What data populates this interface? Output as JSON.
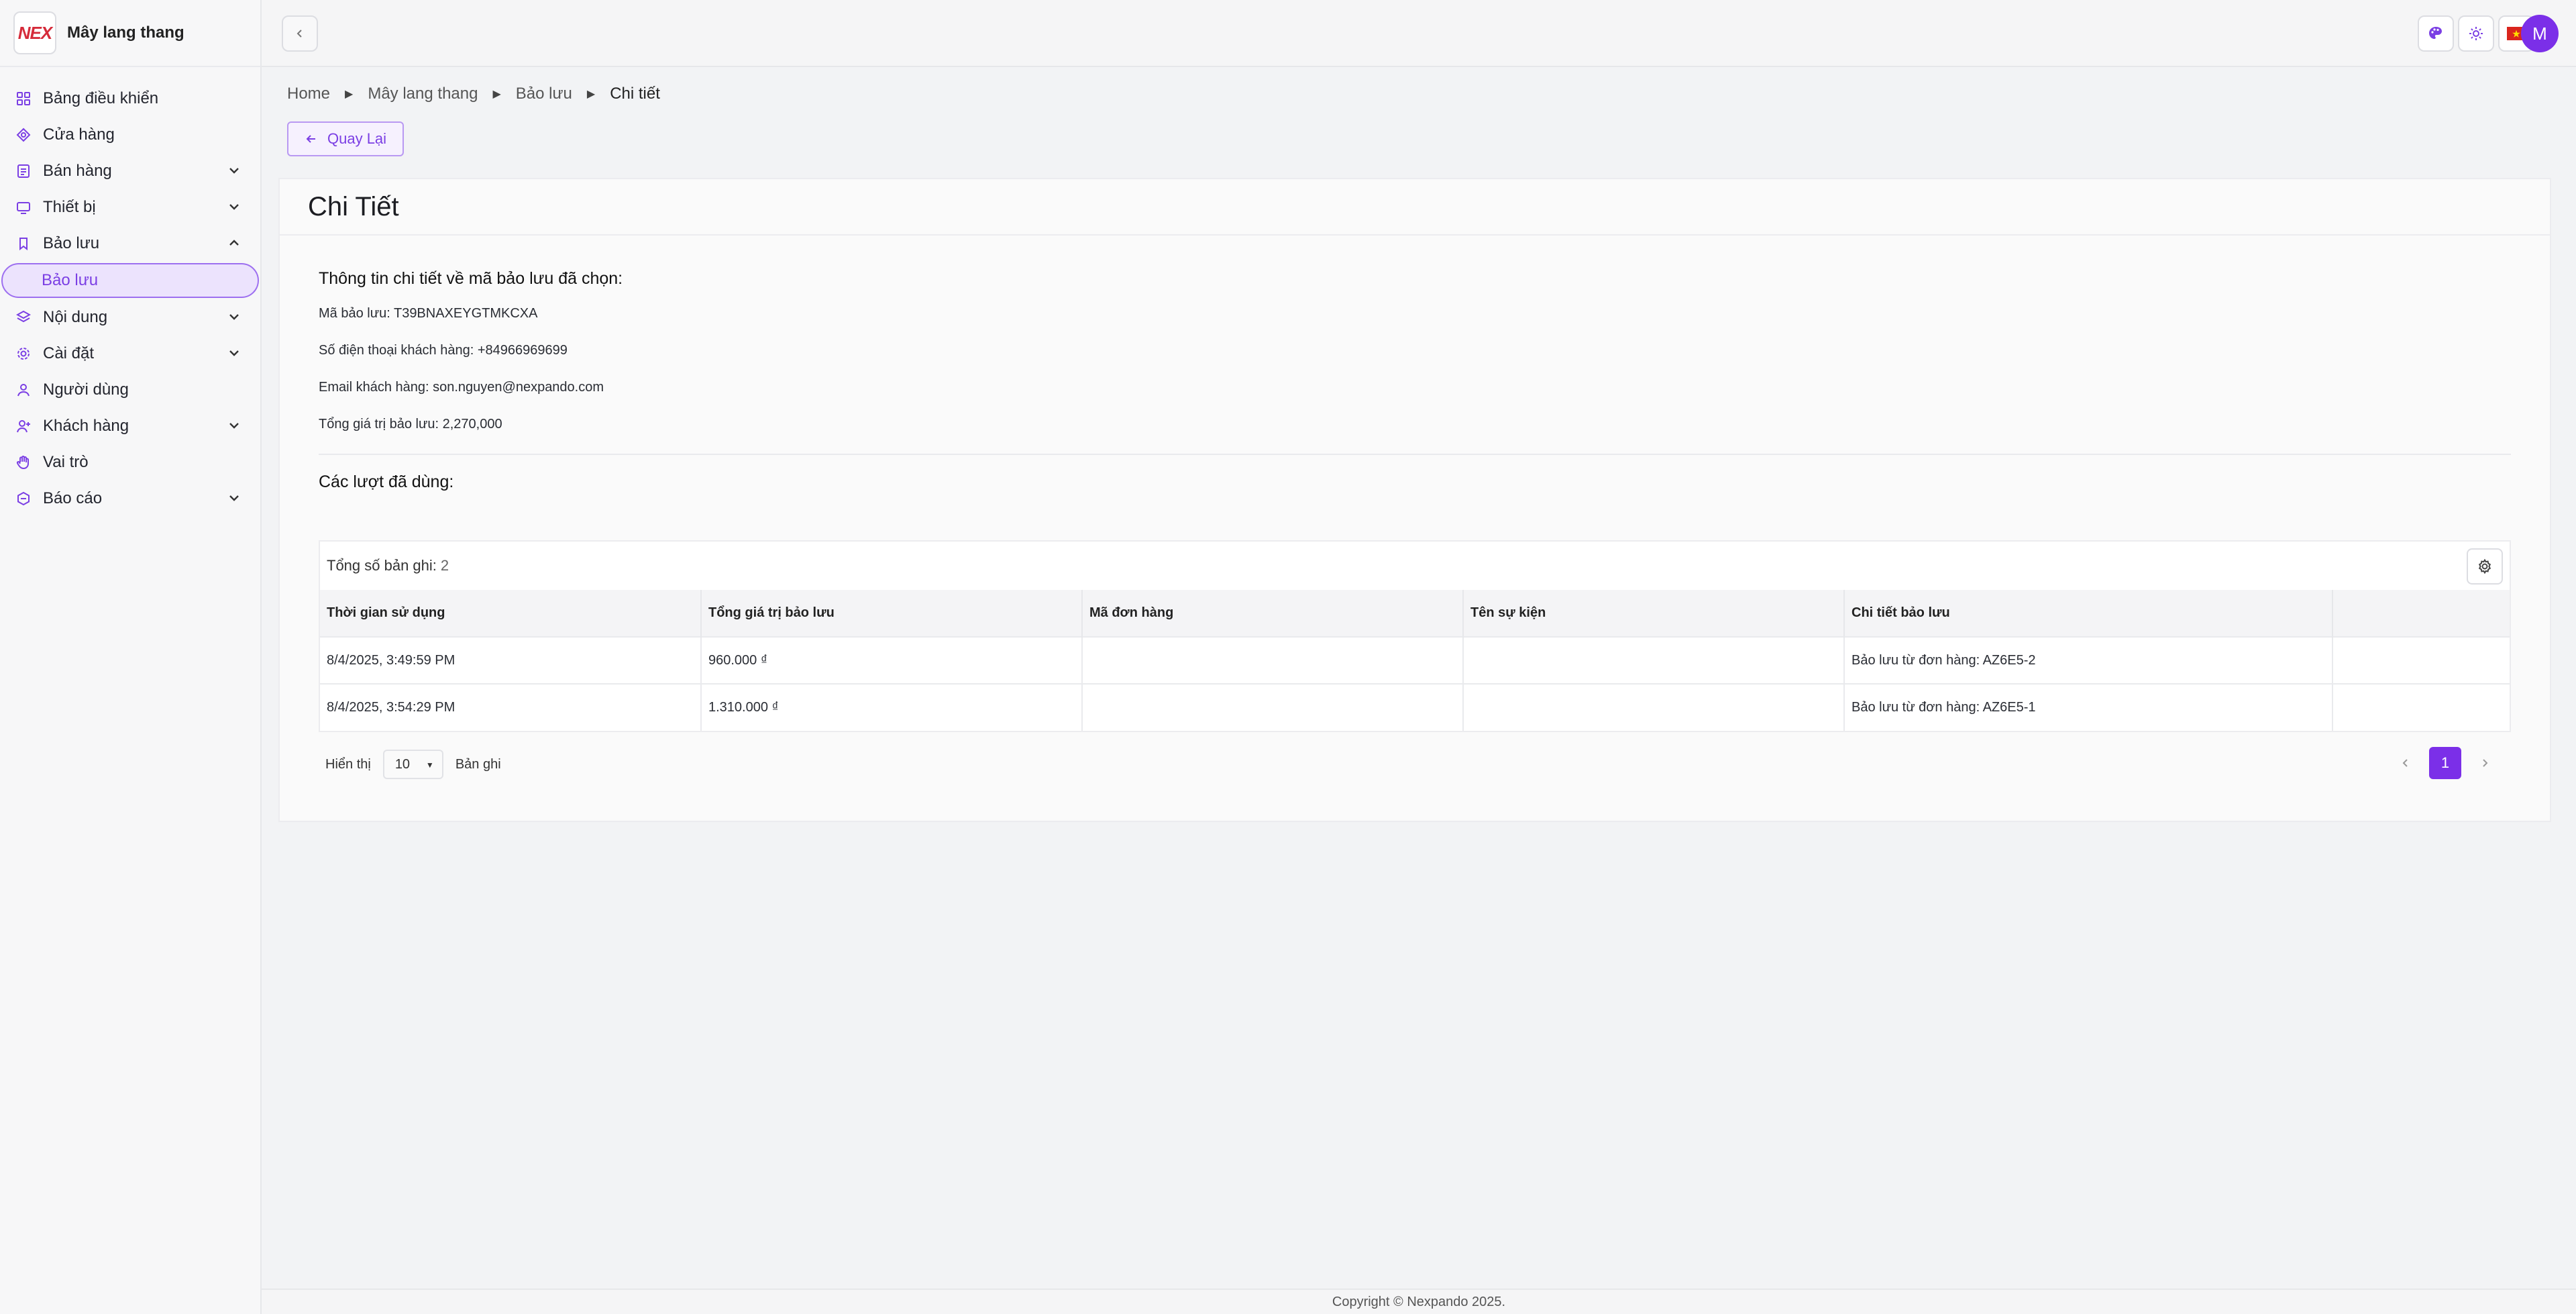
{
  "brand": {
    "logo_text": "NEX",
    "name": "Mây lang thang"
  },
  "sidebar": {
    "items": [
      {
        "label": "Bảng điều khiển"
      },
      {
        "label": "Cửa hàng"
      },
      {
        "label": "Bán hàng"
      },
      {
        "label": "Thiết bị"
      },
      {
        "label": "Bảo lưu"
      },
      {
        "label": "Bảo lưu"
      },
      {
        "label": "Nội dung"
      },
      {
        "label": "Cài đặt"
      },
      {
        "label": "Người dùng"
      },
      {
        "label": "Khách hàng"
      },
      {
        "label": "Vai trò"
      },
      {
        "label": "Báo cáo"
      }
    ]
  },
  "topbar": {
    "avatar_initial": "M",
    "accent": "#7b2fe8"
  },
  "breadcrumb": [
    "Home",
    "Mây lang thang",
    "Bảo lưu",
    "Chi tiết"
  ],
  "back_button": "Quay Lại",
  "card": {
    "title": "Chi Tiết",
    "info_title": "Thông tin chi tiết về mã bảo lưu đã chọn:",
    "info_lines": [
      "Mã bảo lưu: T39BNAXEYGTMKCXA",
      "Số điện thoại khách hàng: +84966969699",
      "Email khách hàng: son.nguyen@nexpando.com",
      "Tổng giá trị bảo lưu: 2,270,000"
    ],
    "usage_title": "Các lượt đã dùng:"
  },
  "table": {
    "total_label": "Tổng số bản ghi:",
    "total_count": "2",
    "columns": [
      "Thời gian sử dụng",
      "Tổng giá trị bảo lưu",
      "Mã đơn hàng",
      "Tên sự kiện",
      "Chi tiết bảo lưu",
      ""
    ],
    "rows": [
      [
        "8/4/2025, 3:49:59 PM",
        "960.000 ₫",
        "",
        "",
        "Bảo lưu từ đơn hàng: AZ6E5-2",
        ""
      ],
      [
        "8/4/2025, 3:54:29 PM",
        "1.310.000 ₫",
        "",
        "",
        "Bảo lưu từ đơn hàng: AZ6E5-1",
        ""
      ]
    ]
  },
  "pagination": {
    "show_label": "Hiển thị",
    "page_size": "10",
    "records_label": "Bản ghi",
    "current_page": "1"
  },
  "footer": "Copyright © Nexpando 2025."
}
